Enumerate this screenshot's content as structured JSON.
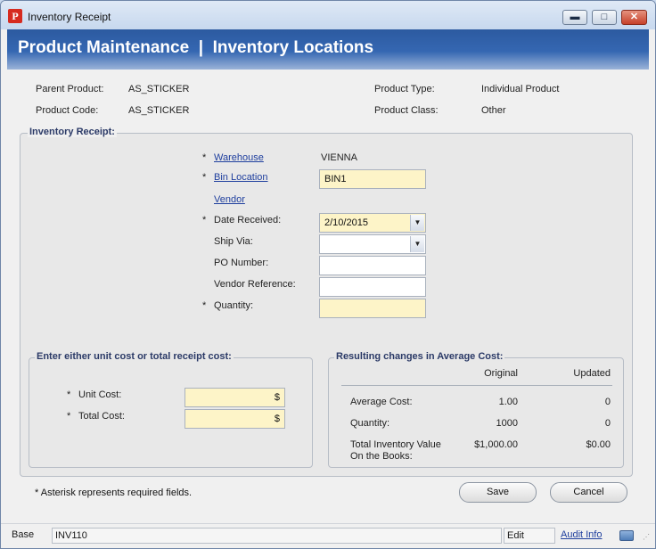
{
  "window": {
    "title": "Inventory Receipt",
    "minimize": "▬",
    "maximize": "□",
    "close": "✕"
  },
  "header": {
    "title": "Product Maintenance  |  Inventory Locations"
  },
  "product": {
    "parent_label": "Parent Product:",
    "parent_value": "AS_STICKER",
    "code_label": "Product Code:",
    "code_value": "AS_STICKER",
    "type_label": "Product Type:",
    "type_value": "Individual Product",
    "class_label": "Product Class:",
    "class_value": "Other"
  },
  "receipt": {
    "title": "Inventory Receipt:",
    "warehouse_label": "Warehouse",
    "warehouse_value": "VIENNA",
    "bin_label": "Bin Location",
    "bin_value": "BIN1",
    "vendor_label": "Vendor",
    "date_label": "Date Received:",
    "date_value": "2/10/2015",
    "shipvia_label": "Ship Via:",
    "shipvia_value": "",
    "po_label": "PO Number:",
    "po_value": "",
    "vendorref_label": "Vendor Reference:",
    "vendorref_value": "",
    "quantity_label": "Quantity:",
    "quantity_value": "",
    "asterisk": "*"
  },
  "cost": {
    "title": "Enter either unit cost or total receipt cost:",
    "unit_label": "Unit Cost:",
    "unit_value": "$",
    "total_label": "Total Cost:",
    "total_value": "$"
  },
  "changes": {
    "title": "Resulting changes in Average Cost:",
    "col_original": "Original",
    "col_updated": "Updated",
    "rows": [
      {
        "label": "Average Cost:",
        "original": "1.00",
        "updated": "0"
      },
      {
        "label": "Quantity:",
        "original": "1000",
        "updated": "0"
      },
      {
        "label": "Total Inventory Value On the Books:",
        "original": "$1,000.00",
        "updated": "$0.00"
      }
    ]
  },
  "footer": {
    "note": "* Asterisk represents required fields.",
    "save": "Save",
    "cancel": "Cancel"
  },
  "statusbar": {
    "base": "Base",
    "code": "INV110",
    "mode": "Edit",
    "audit": "Audit Info"
  }
}
